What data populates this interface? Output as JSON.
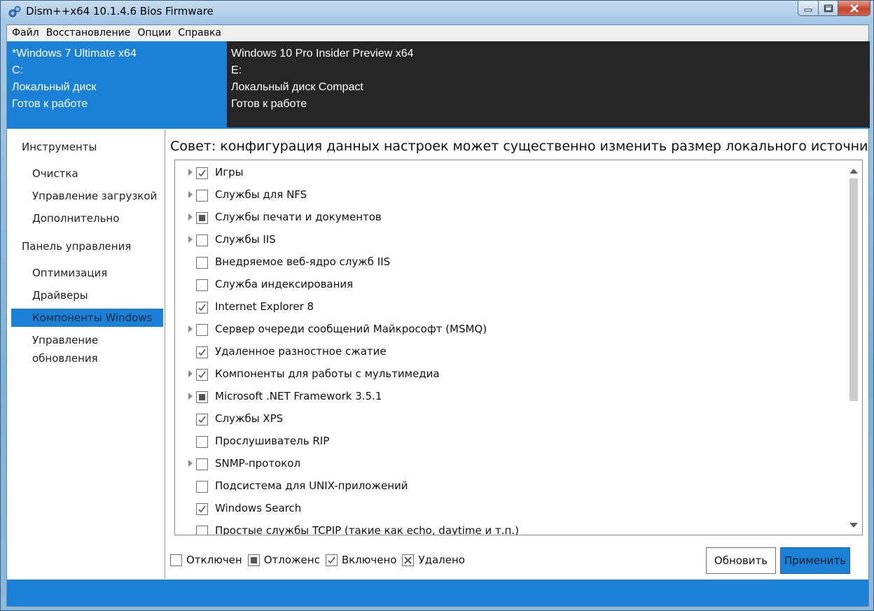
{
  "window": {
    "title": "Dism++x64 10.1.4.6 Bios Firmware"
  },
  "menu": [
    "Файл",
    "Восстановление",
    "Опции",
    "Справка"
  ],
  "images": [
    {
      "os": "*Windows 7 Ultimate x64",
      "drive": "C:",
      "disk": "Локальный диск",
      "status": "Готов к работе"
    },
    {
      "os": "Windows 10 Pro Insider Preview x64",
      "drive": "E:",
      "disk": "Локальный диск Compact",
      "status": "Готов к работе"
    }
  ],
  "sidebar": {
    "group1": "Инструменты",
    "group1_items": [
      "Очистка",
      "Управление загрузкой",
      "Дополнительно"
    ],
    "group2": "Панель управления",
    "group2_items": [
      "Оптимизация",
      "Драйверы",
      "Компоненты Windows",
      "Управление обновления"
    ],
    "active": "Компоненты Windows"
  },
  "main": {
    "hint": "Совет: конфигурация данных настроек может существенно изменить размер локального источни",
    "components": [
      {
        "label": "Игры",
        "state": "checked",
        "expandable": true
      },
      {
        "label": "Службы для NFS",
        "state": "unchecked",
        "expandable": true
      },
      {
        "label": "Службы печати и документов",
        "state": "partial",
        "expandable": true
      },
      {
        "label": "Службы IIS",
        "state": "unchecked",
        "expandable": true
      },
      {
        "label": "Внедряемое веб-ядро служб IIS",
        "state": "unchecked",
        "expandable": false
      },
      {
        "label": "Служба индексирования",
        "state": "unchecked",
        "expandable": false
      },
      {
        "label": "Internet Explorer 8",
        "state": "checked",
        "expandable": false
      },
      {
        "label": "Сервер очереди сообщений Майкрософт (MSMQ)",
        "state": "unchecked",
        "expandable": true
      },
      {
        "label": "Удаленное разностное сжатие",
        "state": "checked",
        "expandable": false
      },
      {
        "label": "Компоненты для работы с мультимедиа",
        "state": "checked",
        "expandable": true
      },
      {
        "label": "Microsoft .NET Framework 3.5.1",
        "state": "partial",
        "expandable": true
      },
      {
        "label": "Службы XPS",
        "state": "checked",
        "expandable": false
      },
      {
        "label": "Прослушиватель RIP",
        "state": "unchecked",
        "expandable": false
      },
      {
        "label": "SNMP-протокол",
        "state": "unchecked",
        "expandable": true
      },
      {
        "label": "Подсистема для UNIX-приложений",
        "state": "unchecked",
        "expandable": false
      },
      {
        "label": "Windows Search",
        "state": "checked",
        "expandable": false
      },
      {
        "label": "Простые службы TCPIP (такие как echo, daytime и т.п.)",
        "state": "unchecked",
        "expandable": false
      }
    ],
    "legend": [
      {
        "label": "Отключен",
        "state": "unchecked"
      },
      {
        "label": "Отложенс",
        "state": "partial"
      },
      {
        "label": "Включено",
        "state": "checked"
      },
      {
        "label": "Удалено",
        "state": "removed"
      }
    ],
    "refresh_label": "Обновить",
    "apply_label": "Применить"
  },
  "colors": {
    "accent": "#1b81d6",
    "dark_panel": "#262626"
  }
}
